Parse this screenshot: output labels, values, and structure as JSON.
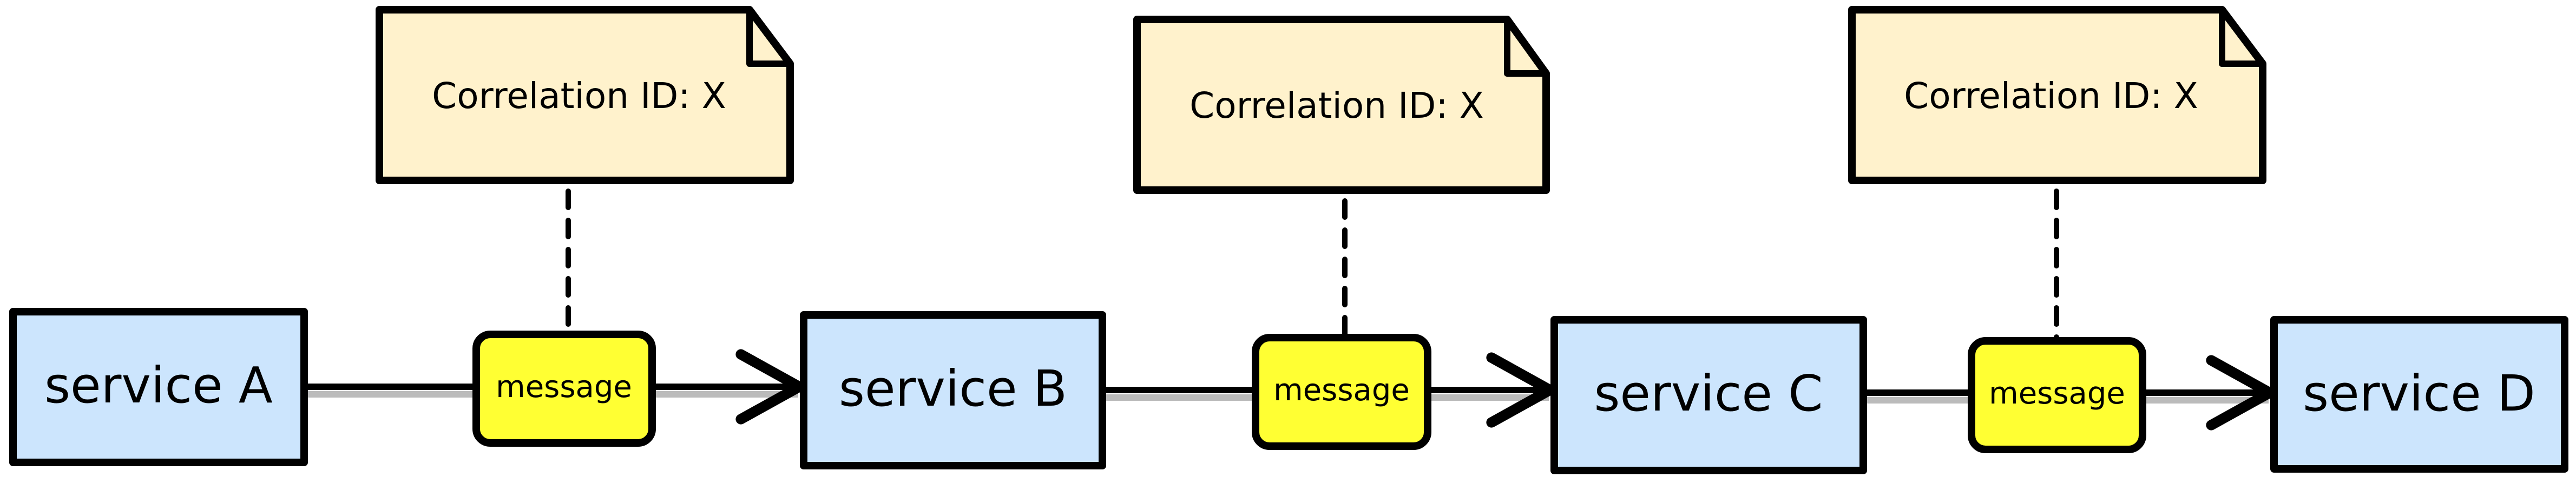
{
  "diagram": {
    "title": "",
    "colors": {
      "service_fill": "#cce5fd",
      "message_fill": "#ffff33",
      "note_fill": "#fff2cc",
      "stroke": "#000000",
      "shadow": "#bbbbbb"
    },
    "services": [
      {
        "id": "A",
        "label": "service A"
      },
      {
        "id": "B",
        "label": "service B"
      },
      {
        "id": "C",
        "label": "service C"
      },
      {
        "id": "D",
        "label": "service D"
      }
    ],
    "messages": [
      {
        "from": "A",
        "to": "B",
        "label": "message",
        "note": "Correlation ID: X"
      },
      {
        "from": "B",
        "to": "C",
        "label": "message",
        "note": "Correlation ID: X"
      },
      {
        "from": "C",
        "to": "D",
        "label": "message",
        "note": "Correlation ID: X"
      }
    ]
  }
}
